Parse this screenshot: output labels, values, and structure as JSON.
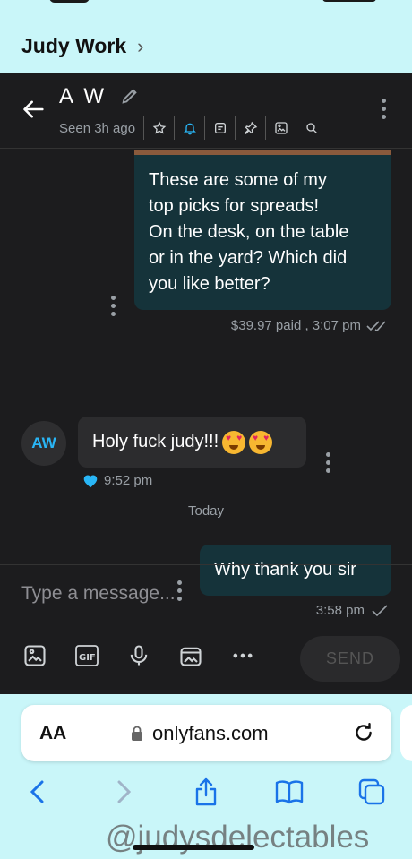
{
  "top": {
    "chat_name": "Judy Work",
    "chevron": "›"
  },
  "header": {
    "contact_name": "A W",
    "seen": "Seen 3h ago",
    "icons": [
      "star-icon",
      "bell-icon",
      "note-icon",
      "pin-icon",
      "image-icon",
      "search-icon"
    ],
    "accent": "#29b6f6"
  },
  "messages": {
    "outgoing_1": {
      "lines": [
        "These are some of my",
        "top picks for spreads!",
        "On the desk, on the table",
        "or in the yard? Which did",
        "you like better?"
      ],
      "meta": "$39.97 paid , 3:07 pm"
    },
    "incoming_1": {
      "avatar": "AW",
      "text": "Holy fuck judy!!!",
      "time": "9:52 pm"
    },
    "divider": "Today",
    "outgoing_2": {
      "text": "Why thank you sir",
      "time": "3:58 pm"
    }
  },
  "composer": {
    "placeholder": "Type a message...",
    "send_label": "SEND",
    "tools": [
      "image-icon",
      "gif-icon",
      "microphone-icon",
      "vault-icon",
      "more-icon"
    ]
  },
  "browser": {
    "aa": "AA",
    "url": "onlyfans.com"
  },
  "watermark": "@judysdelectables"
}
